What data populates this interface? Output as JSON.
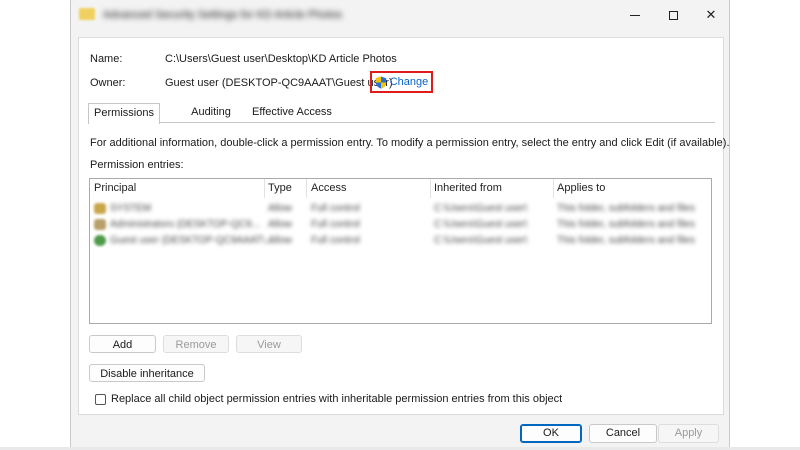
{
  "window": {
    "title": "Advanced Security Settings for KD Article Photos",
    "controls": {
      "minimize": "minimize",
      "maximize": "maximize",
      "close": "✕"
    }
  },
  "info": {
    "name_label": "Name:",
    "name_value": "C:\\Users\\Guest user\\Desktop\\KD Article Photos",
    "owner_label": "Owner:",
    "owner_value": "Guest user (DESKTOP-QC9AAAT\\Guest user)",
    "change_link": "Change",
    "change_highlight_color": "#e01b1b"
  },
  "tabs": [
    {
      "label": "Permissions",
      "active": true
    },
    {
      "label": "Auditing",
      "active": false
    },
    {
      "label": "Effective Access",
      "active": false
    }
  ],
  "permissions": {
    "help_text": "For additional information, double-click a permission entry. To modify a permission entry, select the entry and click Edit (if available).",
    "entries_label": "Permission entries:",
    "columns": [
      "Principal",
      "Type",
      "Access",
      "Inherited from",
      "Applies to"
    ],
    "rows": [
      {
        "icon": "system-group-icon",
        "principal": "SYSTEM",
        "type": "Allow",
        "access": "Full control",
        "inherited_from": "C:\\Users\\Guest user\\",
        "applies_to": "This folder, subfolders and files"
      },
      {
        "icon": "admin-group-icon",
        "principal": "Administrators (DESKTOP-QC9...",
        "type": "Allow",
        "access": "Full control",
        "inherited_from": "C:\\Users\\Guest user\\",
        "applies_to": "This folder, subfolders and files"
      },
      {
        "icon": "user-icon",
        "principal": "Guest user (DESKTOP-QC9AAAT\\...",
        "type": "Allow",
        "access": "Full control",
        "inherited_from": "C:\\Users\\Guest user\\",
        "applies_to": "This folder, subfolders and files"
      }
    ]
  },
  "buttons": {
    "add": "Add",
    "remove": "Remove",
    "view": "View",
    "disable_inheritance": "Disable inheritance",
    "ok": "OK",
    "cancel": "Cancel",
    "apply": "Apply"
  },
  "replace_checkbox": {
    "label": "Replace all child object permission entries with inheritable permission entries from this object",
    "checked": false
  }
}
